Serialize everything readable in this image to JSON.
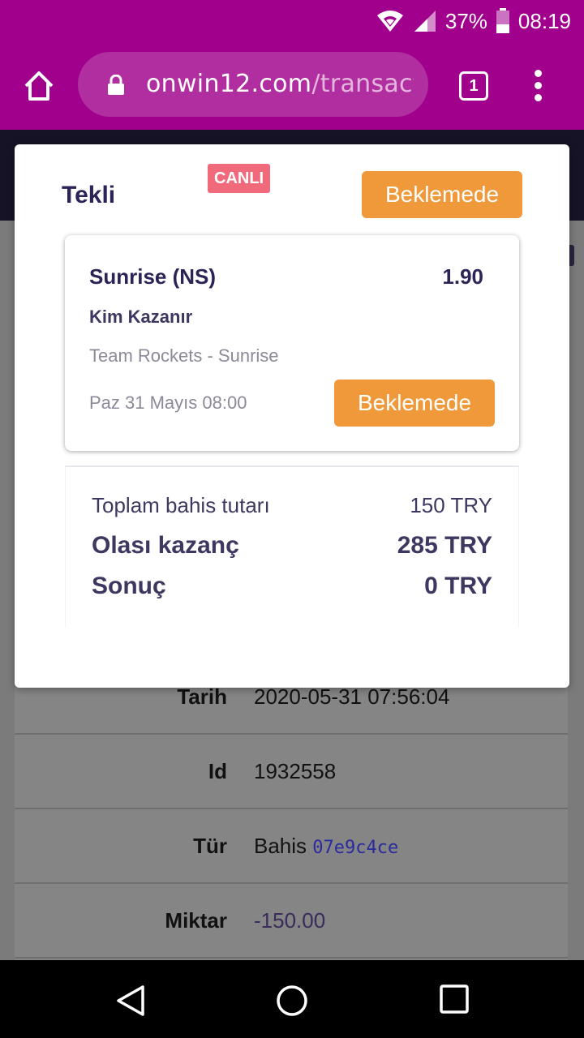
{
  "status_bar": {
    "battery": "37%",
    "time": "08:19"
  },
  "browser": {
    "url_domain": "onwin12.com",
    "url_path": "/transacti",
    "tab_count": "1"
  },
  "page_details": {
    "rows": [
      {
        "label": "Tarih",
        "value": "2020-05-31 07:56:04"
      },
      {
        "label": "Id",
        "value": "1932558"
      },
      {
        "label": "Tür",
        "value": "Bahis",
        "extra": "07e9c4ce"
      },
      {
        "label": "Miktar",
        "value": "-150.00"
      }
    ]
  },
  "modal": {
    "title": "Tekli",
    "live_badge": "CANLI",
    "status_label": "Beklemede",
    "bet": {
      "selection": "Sunrise (NS)",
      "odds": "1.90",
      "market": "Kim Kazanır",
      "match": "Team Rockets - Sunrise",
      "date": "Paz 31 Mayıs 08:00",
      "status_label": "Beklemede"
    },
    "summary": {
      "stake_label": "Toplam bahis tutarı",
      "stake_value": "150 TRY",
      "potential_label": "Olası kazanç",
      "potential_value": "285 TRY",
      "result_label": "Sonuç",
      "result_value": "0 TRY"
    }
  },
  "colors": {
    "brand": "#a0008c",
    "pending": "#f0993a",
    "live": "#f06a7c",
    "text_primary": "#2b2456"
  },
  "icons": [
    "wifi-icon",
    "signal-icon",
    "battery-icon",
    "home-icon",
    "lock-icon",
    "tabs-icon",
    "more-vert-icon",
    "nav-back-icon",
    "nav-home-icon",
    "nav-recents-icon"
  ]
}
